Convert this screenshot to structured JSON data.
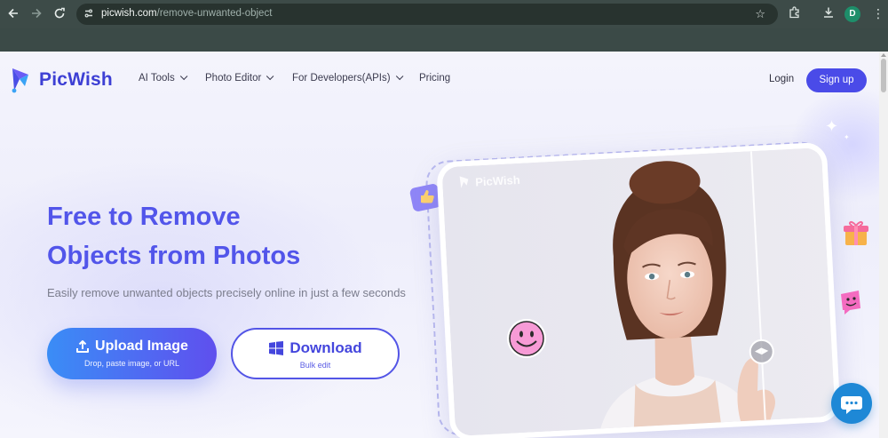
{
  "browser": {
    "url_domain": "picwish.com",
    "url_path": "/remove-unwanted-object",
    "profile_initial": "D",
    "back_icon": "arrow-left-icon",
    "forward_icon": "arrow-right-icon",
    "reload_icon": "reload-icon"
  },
  "nav": {
    "brand": "PicWish",
    "items": [
      {
        "label": "AI Tools",
        "has_dropdown": true
      },
      {
        "label": "Photo Editor",
        "has_dropdown": true
      },
      {
        "label": "For Developers(APIs)",
        "has_dropdown": true
      },
      {
        "label": "Pricing",
        "has_dropdown": false
      }
    ],
    "login": "Login",
    "signup": "Sign up"
  },
  "hero": {
    "title_line1": "Free to Remove",
    "title_line2": "Objects from Photos",
    "subtitle": "Easily remove unwanted objects precisely online in just a few seconds",
    "upload": {
      "label": "Upload Image",
      "sublabel": "Drop, paste image, or URL"
    },
    "download": {
      "label": "Download",
      "sublabel": "Bulk edit"
    },
    "watermark": "PicWish"
  },
  "colors": {
    "brand": "#4a4be8",
    "title": "#5255ea",
    "chrome": "#3b4a47"
  }
}
